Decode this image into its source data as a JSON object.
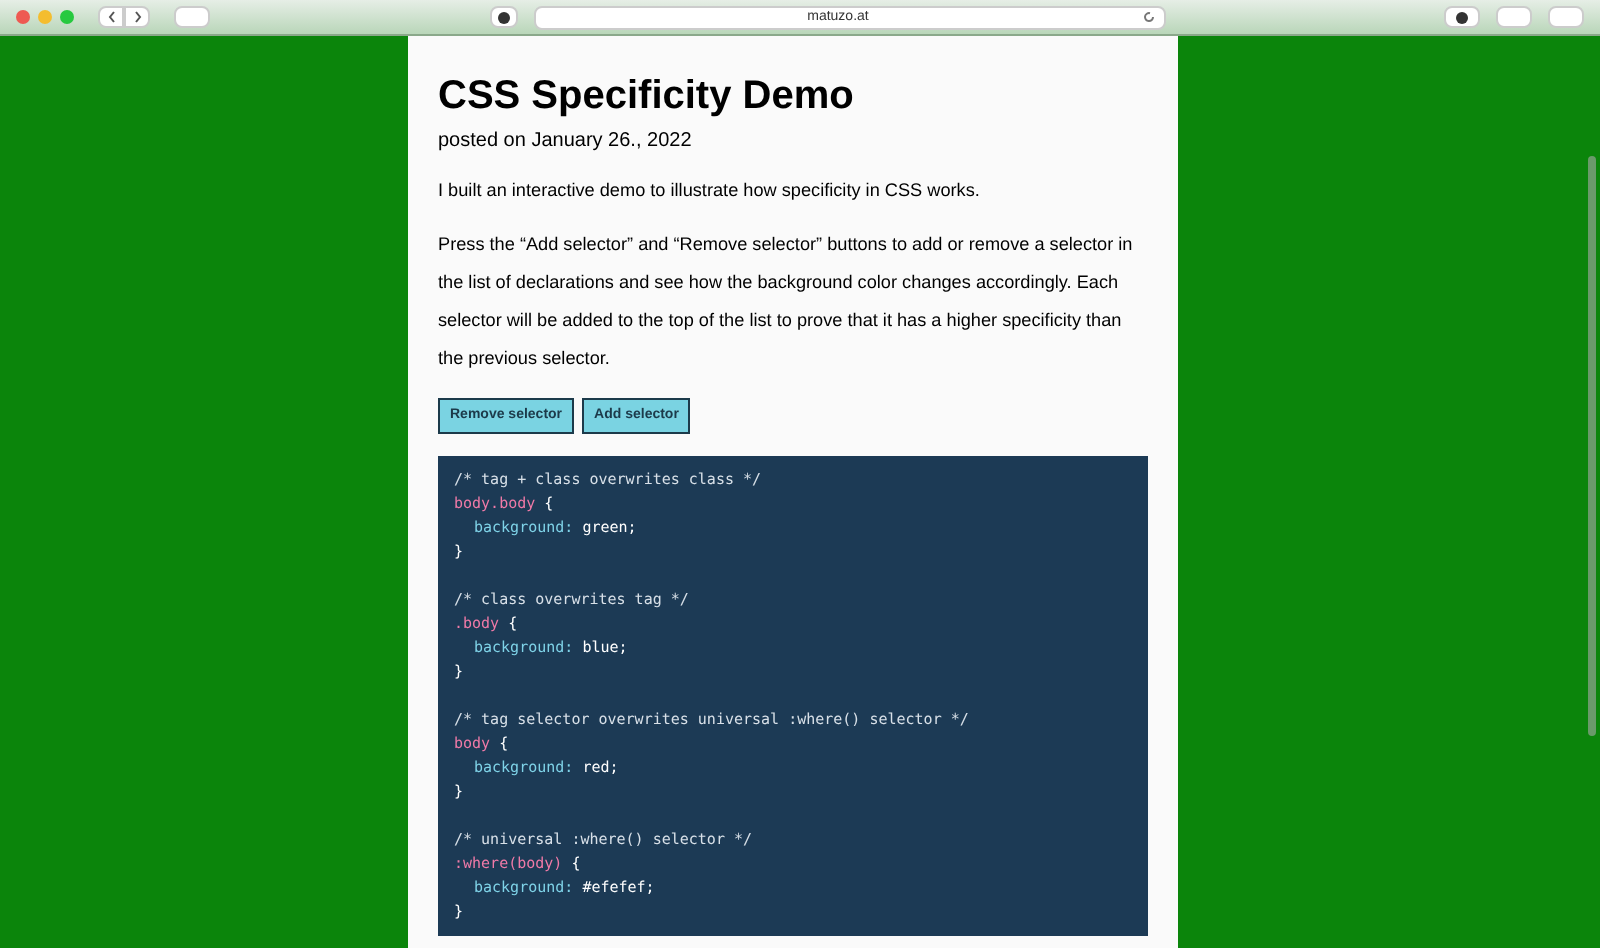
{
  "browser": {
    "url": "matuzo.at"
  },
  "article": {
    "title": "CSS Specificity Demo",
    "date": "posted on January 26., 2022",
    "paragraphs": [
      "I built an interactive demo to illustrate how specificity in CSS works.",
      "Press the “Add selector” and “Remove selector” buttons to add or remove a selector in the list of declarations and see how the background color changes accordingly. Each selector will be added to the top of the list to prove that it has a higher specificity than the previous selector."
    ],
    "buttons": [
      "Remove selector",
      "Add selector"
    ],
    "code": [
      {
        "comment": "/* tag + class overwrites class */",
        "selector": "body.body",
        "open": "{",
        "property": "background:",
        "value": "green;",
        "close": "}"
      },
      {
        "comment": "/* class overwrites tag */",
        "selector": ".body",
        "open": "{",
        "property": "background:",
        "value": "blue;",
        "close": "}"
      },
      {
        "comment": "/* tag selector overwrites universal :where() selector */",
        "selector": "body",
        "open": "{",
        "property": "background:",
        "value": "red;",
        "close": "}"
      },
      {
        "comment": "/* universal :where() selector */",
        "selector": ":where(body)",
        "open": "{",
        "property": "background:",
        "value": "#efefef;",
        "close": "}"
      }
    ]
  }
}
